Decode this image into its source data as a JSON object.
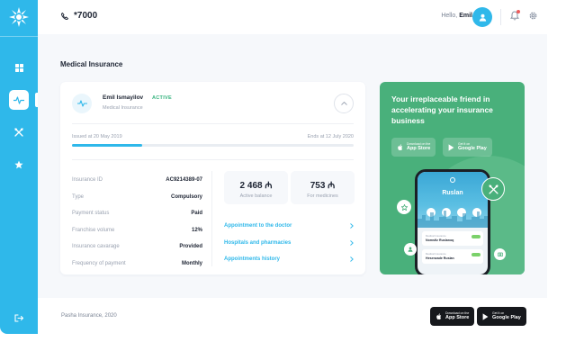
{
  "topbar": {
    "phone": "*7000",
    "greeting": "Hello,",
    "user_name": "Emil"
  },
  "sidebar": {
    "items": [
      {
        "name": "dashboard",
        "icon": "grid-icon",
        "active": false
      },
      {
        "name": "medical",
        "icon": "pulse-icon",
        "active": true
      },
      {
        "name": "services",
        "icon": "tools-icon",
        "active": false
      },
      {
        "name": "favorites",
        "icon": "star-icon",
        "active": false
      }
    ],
    "logout_icon": "logout-icon"
  },
  "page": {
    "title": "Medical Insurance"
  },
  "policy": {
    "holder": "Emil Ismayilov",
    "status": "ACTIVE",
    "product": "Medical Insurance",
    "issued": "Issued at 20 May 2019",
    "ends": "Ends at 12 July 2020",
    "progress": 0.25,
    "details": [
      {
        "label": "Insurance ID",
        "value": "AC9214389-07"
      },
      {
        "label": "Type",
        "value": "Compulsory"
      },
      {
        "label": "Payment status",
        "value": "Paid"
      },
      {
        "label": "Franchise volume",
        "value": "12%"
      },
      {
        "label": "Insurance cavarage",
        "value": "Provided"
      },
      {
        "label": "Frequency of payment",
        "value": "Monthly"
      }
    ],
    "active_balance": {
      "value": "2 468 ₼",
      "label": "Active balance"
    },
    "medicines": {
      "value": "753 ₼",
      "label": "For medicines"
    },
    "links": [
      "Appointment to the doctor",
      "Hospitals and pharmacies",
      "Appointments history"
    ]
  },
  "promo": {
    "headline": "Your irreplaceable friend in accelerating your insurance business",
    "app_store_top": "Download on the",
    "app_store": "App Store",
    "google_play_top": "Get it on",
    "google_play": "Google Play",
    "phone_user": "Ruslan",
    "card1_title": "Medical Insurance",
    "card1_name": "Nomsfiz Ruslanoq",
    "card2_title": "Medical Insurance",
    "card2_name": "Hesenzade Ruslan"
  },
  "footer": {
    "copyright": "Pasha Insurance, 2020",
    "app_store_top": "Download on the",
    "app_store": "App Store",
    "google_play_top": "Get it on",
    "google_play": "Google Play"
  },
  "colors": {
    "primary": "#2fb8ea",
    "promo": "#49b07b",
    "active": "#36b37e"
  }
}
